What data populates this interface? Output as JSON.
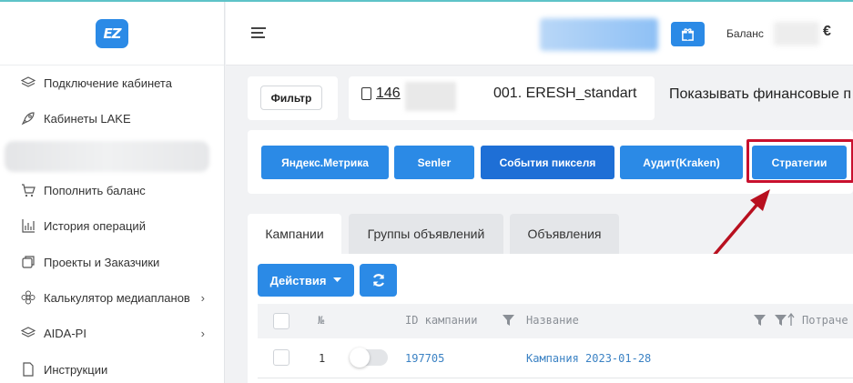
{
  "brand": {
    "logo_text": "EZ",
    "accent": "#2b8ae6"
  },
  "sidebar": {
    "items": [
      {
        "label": "Подключение кабинета",
        "icon": "layers-icon"
      },
      {
        "label": "Кабинеты LAKE",
        "icon": "rocket-icon"
      },
      {
        "label": "Пополнить баланс",
        "icon": "cart-icon"
      },
      {
        "label": "История операций",
        "icon": "bar-chart-icon"
      },
      {
        "label": "Проекты и Заказчики",
        "icon": "copy-icon"
      },
      {
        "label": "Калькулятор медиапланов",
        "icon": "flower-icon",
        "chevron": "›"
      },
      {
        "label": "AIDA-PI",
        "icon": "layers-icon",
        "chevron": "›"
      },
      {
        "label": "Инструкции",
        "icon": "file-icon"
      }
    ]
  },
  "header": {
    "balance_label": "Баланс",
    "currency": "€"
  },
  "filter": {
    "label": "Фильтр"
  },
  "account": {
    "id_visible": "146",
    "name": "001. ERESH_standart"
  },
  "show_financial": "Показывать финансовые п",
  "buttons": {
    "metrika": "Яндекс.Метрика",
    "senler": "Senler",
    "pixel_events": "События пикселя",
    "audit": "Аудит(Kraken)",
    "strategies": "Стратегии"
  },
  "tabs": [
    "Кампании",
    "Группы объявлений",
    "Объявления"
  ],
  "table": {
    "actions_label": "Действия",
    "columns": {
      "num": "№",
      "id": "ID кампании",
      "name": "Название",
      "spent": "Потраче"
    },
    "rows": [
      {
        "num": "1",
        "id": "197705",
        "name": "Кампания 2023-01-28"
      }
    ]
  }
}
